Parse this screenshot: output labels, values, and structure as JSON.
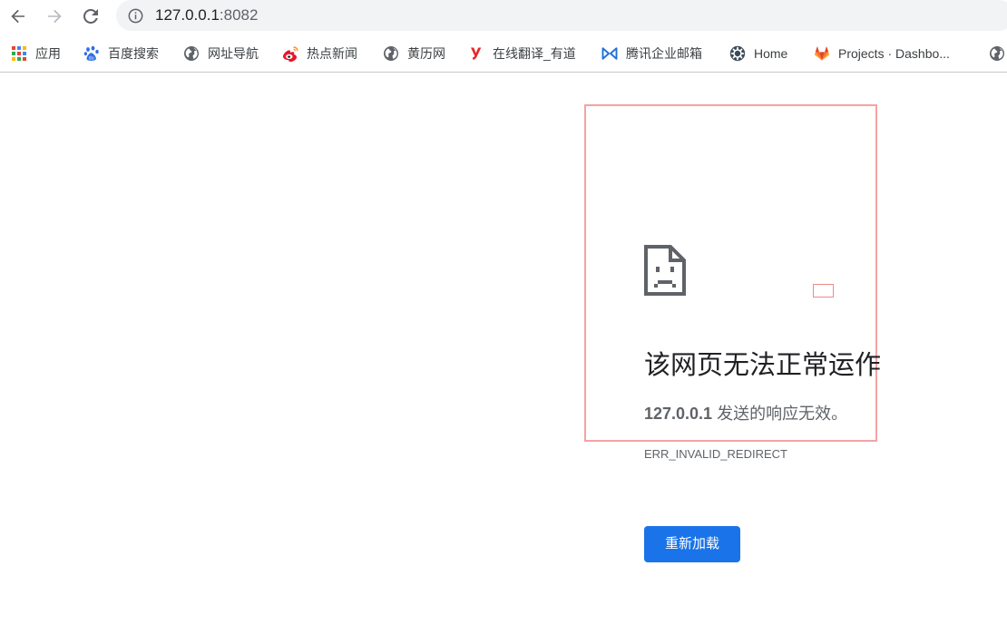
{
  "toolbar": {
    "url_host": "127.0.0.1",
    "url_port": ":8082",
    "icons": {
      "back": "arrow-left-icon",
      "forward": "arrow-right-icon",
      "reload": "reload-icon",
      "info": "info-icon"
    }
  },
  "bookmarks": {
    "items": [
      {
        "label": "应用",
        "icon": "apps-grid-icon"
      },
      {
        "label": "百度搜索",
        "icon": "baidu-paw-icon"
      },
      {
        "label": "网址导航",
        "icon": "globe-icon"
      },
      {
        "label": "热点新闻",
        "icon": "weibo-icon"
      },
      {
        "label": "黄历网",
        "icon": "globe-icon"
      },
      {
        "label": "在线翻译_有道",
        "icon": "youdao-icon"
      },
      {
        "label": "腾讯企业邮箱",
        "icon": "tencent-mail-icon"
      },
      {
        "label": "Home",
        "icon": "gear-icon"
      },
      {
        "label": "Projects · Dashbo...",
        "icon": "gitlab-icon"
      },
      {
        "label": "",
        "icon": "globe-icon"
      }
    ]
  },
  "error_page": {
    "title": "该网页无法正常运作",
    "desc_host": "127.0.0.1",
    "desc_rest": " 发送的响应无效。",
    "code": "ERR_INVALID_REDIRECT",
    "reload_label": "重新加载",
    "icon": "sad-page-icon"
  },
  "colors": {
    "button_blue": "#1a73e8",
    "annotation_red": "#f4a3a3",
    "text_secondary": "#5f6368"
  }
}
